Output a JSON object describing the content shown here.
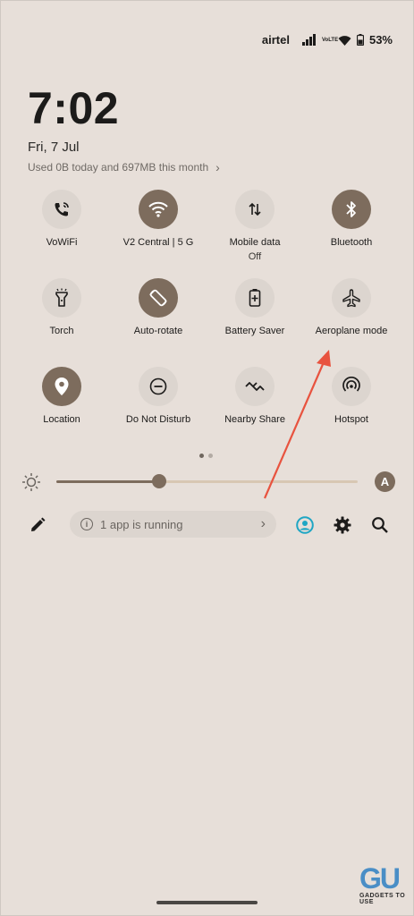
{
  "status_bar": {
    "carrier": "airtel",
    "volte": "VoLTE",
    "battery": "53%"
  },
  "clock": {
    "time": "7:02",
    "date": "Fri, 7 Jul",
    "usage": "Used 0B today and 697MB this month"
  },
  "tiles": [
    {
      "label": "VoWiFi",
      "sub": "",
      "on": false,
      "icon": "wifi-calling-icon"
    },
    {
      "label": "V2 Central | 5 G",
      "sub": "",
      "on": true,
      "icon": "wifi-icon"
    },
    {
      "label": "Mobile data",
      "sub": "Off",
      "on": false,
      "icon": "mobile-data-icon"
    },
    {
      "label": "Bluetooth",
      "sub": "",
      "on": true,
      "icon": "bluetooth-icon"
    },
    {
      "label": "Torch",
      "sub": "",
      "on": false,
      "icon": "torch-icon"
    },
    {
      "label": "Auto-rotate",
      "sub": "",
      "on": true,
      "icon": "rotate-icon"
    },
    {
      "label": "Battery Saver",
      "sub": "",
      "on": false,
      "icon": "battery-saver-icon"
    },
    {
      "label": "Aeroplane mode",
      "sub": "",
      "on": false,
      "icon": "airplane-icon"
    },
    {
      "label": "Location",
      "sub": "",
      "on": true,
      "icon": "location-icon"
    },
    {
      "label": "Do Not Disturb",
      "sub": "",
      "on": false,
      "icon": "dnd-icon"
    },
    {
      "label": "Nearby Share",
      "sub": "",
      "on": false,
      "icon": "nearby-share-icon"
    },
    {
      "label": "Hotspot",
      "sub": "",
      "on": false,
      "icon": "hotspot-icon"
    }
  ],
  "brightness": {
    "level": 0.34,
    "auto_label": "A"
  },
  "bottom": {
    "running_text": "1 app is running"
  },
  "watermark": {
    "logo": "GU",
    "text": "GADGETS TO USE"
  },
  "colors": {
    "background": "#e7dfd9",
    "tile_on": "#7d6c5d",
    "tile_off": "#dcd5cf",
    "annotation_arrow": "#e8533f"
  }
}
